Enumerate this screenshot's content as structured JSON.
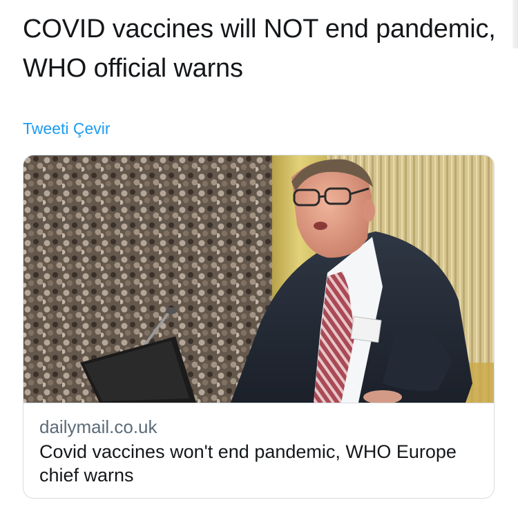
{
  "tweet": {
    "text": "COVID vaccines will NOT end pandemic, WHO official warns",
    "translate_label": "Tweeti Çevir"
  },
  "link_card": {
    "domain": "dailymail.co.uk",
    "title": "Covid vaccines won't end pandemic, WHO Europe chief warns",
    "image_alt": "WHO official speaking at a podium in front of a crowd photo"
  }
}
